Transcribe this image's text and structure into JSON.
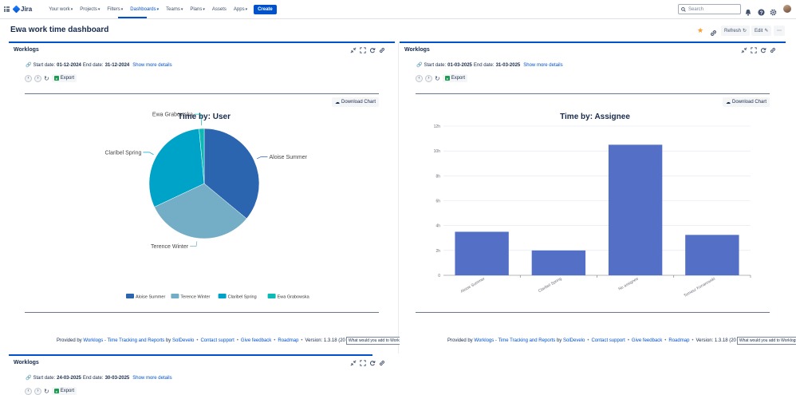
{
  "nav": {
    "logo_text": "Jira",
    "items": [
      {
        "label": "Your work",
        "caret": true
      },
      {
        "label": "Projects",
        "caret": true
      },
      {
        "label": "Filters",
        "caret": true
      },
      {
        "label": "Dashboards",
        "caret": true,
        "active": true
      },
      {
        "label": "Teams",
        "caret": true
      },
      {
        "label": "Plans",
        "caret": true
      },
      {
        "label": "Assets",
        "caret": false
      },
      {
        "label": "Apps",
        "caret": true
      }
    ],
    "create_label": "Create",
    "search_placeholder": "Search"
  },
  "dashboard": {
    "title": "Ewa work time dashboard",
    "refresh_label": "Refresh",
    "edit_label": "Edit",
    "more_label": "⋯"
  },
  "gadgets": [
    {
      "title": "Worklogs",
      "start_label": "Start date:",
      "start_date": "01-12-2024",
      "end_label": "End date:",
      "end_date": "31-12-2024",
      "more_details": "Show more details",
      "export_label": "Export",
      "download_label": "Download Chart"
    },
    {
      "title": "Worklogs",
      "start_label": "Start date:",
      "start_date": "01-03-2025",
      "end_label": "End date:",
      "end_date": "31-03-2025",
      "more_details": "Show more details",
      "export_label": "Export",
      "download_label": "Download Chart"
    },
    {
      "title": "Worklogs",
      "start_label": "Start date:",
      "start_date": "24-03-2025",
      "end_label": "End date:",
      "end_date": "30-03-2025",
      "more_details": "Show more details",
      "export_label": "Export"
    }
  ],
  "footer": {
    "provided_by": "Provided by",
    "app_link": "Worklogs - Time Tracking and Reports",
    "by": "by",
    "vendor": "SolDevelo",
    "contact": "Contact support",
    "feedback": "Give feedback",
    "roadmap": "Roadmap",
    "version": "Version: 1.3.18 (20",
    "ask": "What would you add to Worklogs?"
  },
  "colors": {
    "accent": "#0052cc",
    "bar": "#5470c6",
    "pie": [
      "#2b65b0",
      "#73adc6",
      "#00a3c8",
      "#0bbab5"
    ]
  },
  "chart_data": [
    {
      "type": "pie",
      "title": "Time by: User",
      "labels": [
        "Aloise Summer",
        "Terence Winter",
        "Claribel Spring",
        "Ewa Grabowska"
      ],
      "values": [
        36,
        32,
        30.5,
        1.5
      ],
      "legend": "bottom"
    },
    {
      "type": "bar",
      "title": "Time by: Assignee",
      "categories": [
        "Aloise Summer",
        "Claribel Spring",
        "No assignee",
        "Tomasz Konarowski"
      ],
      "values": [
        3.5,
        2,
        10.5,
        3.25
      ],
      "ylim": [
        0,
        12
      ],
      "yticks": [
        "0",
        "2h",
        "4h",
        "6h",
        "8h",
        "10h",
        "12h"
      ],
      "grid": true
    }
  ]
}
